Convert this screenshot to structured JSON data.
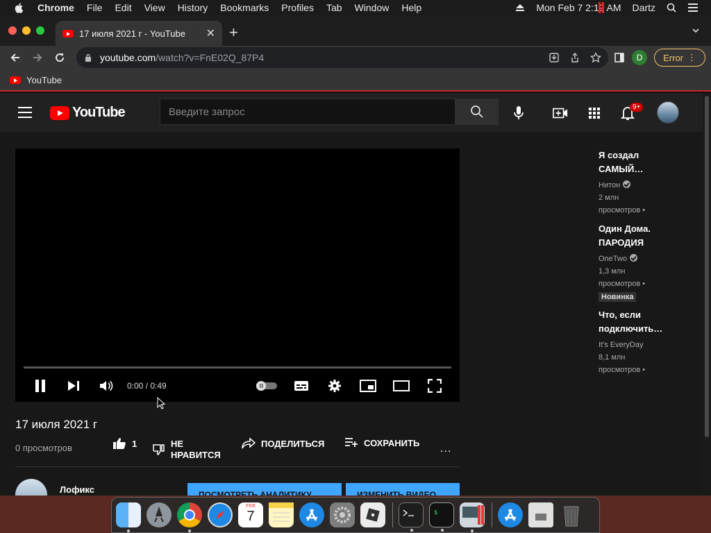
{
  "menubar": {
    "app": "Chrome",
    "items": [
      "File",
      "Edit",
      "View",
      "History",
      "Bookmarks",
      "Profiles",
      "Tab",
      "Window",
      "Help"
    ],
    "clock": "Mon Feb 7  2:19 AM",
    "user": "Dartz"
  },
  "browser": {
    "tab_title": "17 июля 2021 г - YouTube",
    "url_host": "youtube.com",
    "url_path": "/watch?v=FnE02Q_87P4",
    "profile_initial": "D",
    "error_label": "Error",
    "bookmark": "YouTube"
  },
  "youtube": {
    "logo_text": "YouTube",
    "search_placeholder": "Введите запрос",
    "notifications": "9+",
    "player": {
      "time": "0:00 / 0:49"
    },
    "video": {
      "title": "17 июля 2021 г",
      "views": "0 просмотров",
      "likes": "1",
      "dislike_line1": "НЕ",
      "dislike_line2": "НРАВИТСЯ",
      "share": "ПОДЕЛИТЬСЯ",
      "save": "СОХРАНИТЬ",
      "more": "..."
    },
    "channel": {
      "name": "Лофикс",
      "analytics_button": "ПОСМОТРЕТЬ АНАЛИТИКУ",
      "edit_button": "ИЗМЕНИТЬ ВИДЕО"
    },
    "recommendations": [
      {
        "title1": "Я создал",
        "title2": "САМЫЙ…",
        "channel": "Нитон",
        "views": "2 млн",
        "views2": "просмотров •"
      },
      {
        "title1": "Один Дома.",
        "title2": "ПАРОДИЯ",
        "channel": "OneTwo",
        "views": "1,3 млн",
        "views2": "просмотров •",
        "badge": "Новинка"
      },
      {
        "title1": "Что, если",
        "title2": "подключить…",
        "channel": "It's EveryDay",
        "views": "8,1 млн",
        "views2": "просмотров •"
      }
    ]
  },
  "dock": {
    "apps": [
      "finder-icon",
      "launchpad-icon",
      "chrome-icon",
      "safari-icon",
      "calendar-icon",
      "notes-icon",
      "app-store-icon",
      "system-preferences-icon",
      "roblox-icon",
      "terminal-icon",
      "iterm-icon",
      "screen-recorder-icon",
      "app-store-downloads-icon",
      "file-icon",
      "trash-icon"
    ],
    "calendar_month": "FEB",
    "calendar_day": "7"
  }
}
